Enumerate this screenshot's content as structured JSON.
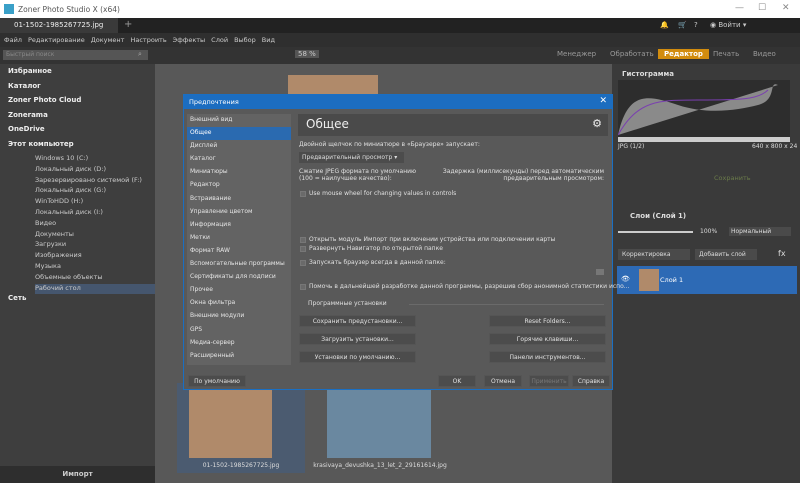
{
  "window": {
    "title": "Zoner Photo Studio X (x64)",
    "controls": [
      "—",
      "☐",
      "✕"
    ]
  },
  "tab": {
    "label": "01-1502-1985267725.jpg",
    "add": "+"
  },
  "header_right": {
    "login": "Войти"
  },
  "menu": [
    "Файл",
    "Редактирование",
    "Документ",
    "Настроить",
    "Эффекты",
    "Слой",
    "Выбор",
    "Вид"
  ],
  "toolbar": {
    "search_placeholder": "Быстрый поиск",
    "zoom": "58 %"
  },
  "modules": [
    "Менеджер",
    "Обработать",
    "Редактор",
    "Печать",
    "Видео"
  ],
  "active_module": "Редактор",
  "navigator": {
    "roots": [
      "Избранное",
      "Каталог",
      "Zoner Photo Cloud",
      "Zonerama",
      "OneDrive",
      "Этот компьютер"
    ],
    "computer": [
      "Windows 10 (C:)",
      "Локальный диск (D:)",
      "Зарезервировано системой (F:)",
      "Локальный диск (G:)",
      "WinToHDD (H:)",
      "Локальный диск (I:)",
      "Видео",
      "Документы",
      "Загрузки",
      "Изображения",
      "Музыка",
      "Объемные объекты",
      "Рабочий стол"
    ],
    "network": "Сеть",
    "import": "Импорт"
  },
  "files": [
    {
      "name": "01-1502-1985267725.jpg"
    },
    {
      "name": "krasivaya_devushka_13_let_2_29161614.jpg"
    }
  ],
  "right": {
    "histogram_title": "Гистограмма",
    "format": "JPG  (1/2)",
    "dims": "640 x 800 x 24",
    "save": "Сохранить",
    "layers_title": "Слои (Слой 1)",
    "opacity": "100%",
    "blend": "Нормальный",
    "adjust": "Корректировка",
    "add_layer": "Добавить слой",
    "fx": "fx",
    "layer_name": "Слой 1"
  },
  "dialog": {
    "title": "Предпочтения",
    "close": "✕",
    "heading": "Общее",
    "nav": [
      "Внешний вид",
      "Общее",
      "Дисплей",
      "Каталог",
      "Миниатюры",
      "Редактор",
      "Встраивание",
      "Управление цветом",
      "Информация",
      "Метки",
      "Формат RAW",
      "Вспомогательные программы",
      "Сертификаты для подписи",
      "Прочее",
      "Окна фильтра",
      "Внешние модули",
      "GPS",
      "Медиа-сервер",
      "Расширенный"
    ],
    "dbl_label": "Двойной щелчок по миниатюре в «Браузере» запускает:",
    "dbl_value": "Предварительный просмотр",
    "jpeg_label1": "Сжатие JPEG формата по умолчанию",
    "jpeg_label2": "(100 = наилучшее качество):",
    "delay_label1": "Задержка (миллисекунды) перед автоматическим",
    "delay_label2": "предварительным просмотром:",
    "cb_wheel": "Use mouse wheel for changing values in controls",
    "cb_import": "Открыть модуль Импорт при включении устройства или подключении карты",
    "cb_nav": "Развернуть Навигатор по открытой папке",
    "cb_browser": "Запускать браузер всегда в данной папке:",
    "cb_stats": "Помочь в дальнейшей разработке данной программы, разрешив сбор анонимной статистики испо...",
    "group": "Программные установки",
    "buttons": [
      "Сохранить предустановки...",
      "Reset Folders...",
      "Загрузить установки...",
      "Горячие клавиши...",
      "Установки по умолчанию...",
      "Панели инструментов..."
    ],
    "defaults": "По умолчанию",
    "ok": "OK",
    "cancel": "Отмена",
    "apply": "Применить",
    "help": "Справка"
  }
}
